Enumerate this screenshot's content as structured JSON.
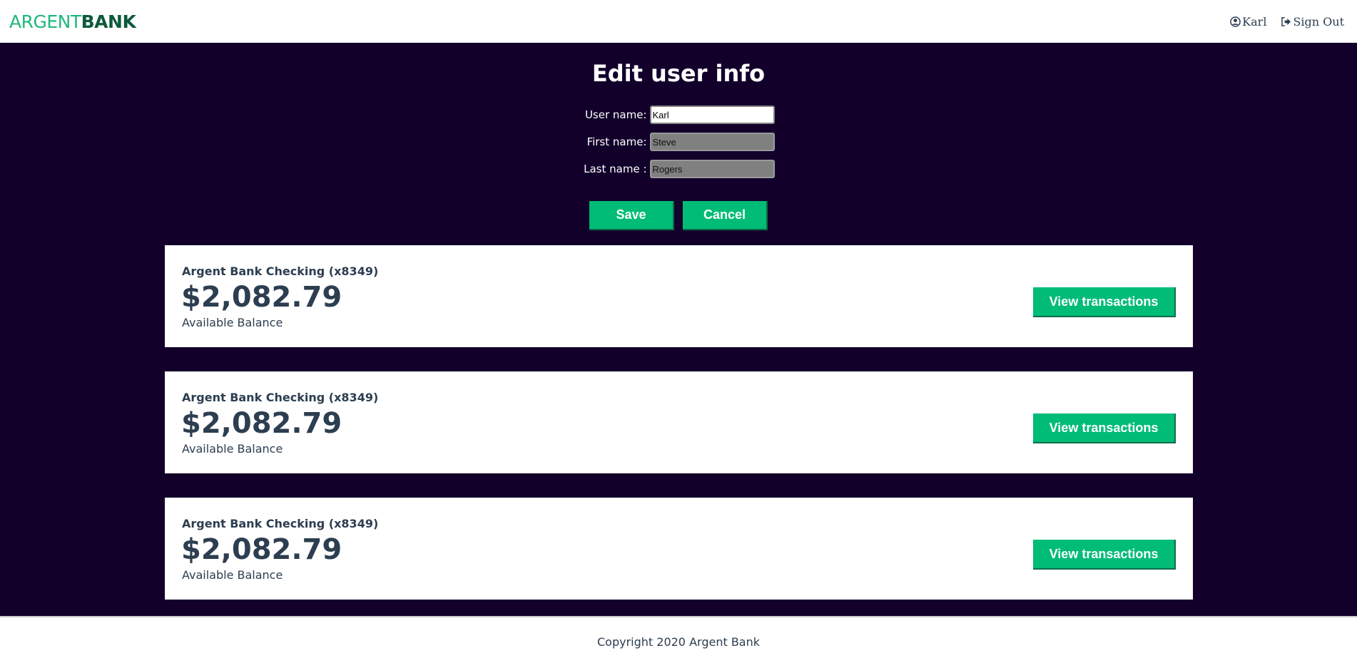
{
  "header": {
    "logo_part1": "ARGENT",
    "logo_part2": "BANK",
    "user_name": "Karl",
    "signout_label": "Sign Out",
    "user_icon": "user-circle-icon",
    "signout_icon": "sign-out-icon"
  },
  "edit_form": {
    "title": "Edit user info",
    "fields": [
      {
        "label": "User name:",
        "value": "Karl",
        "editable": true
      },
      {
        "label": "First name:",
        "value": "Steve",
        "editable": false
      },
      {
        "label": "Last name :",
        "value": "Rogers",
        "editable": false
      }
    ],
    "save_label": "Save",
    "cancel_label": "Cancel"
  },
  "accounts": [
    {
      "title": "Argent Bank Checking (x8349)",
      "amount": "$2,082.79",
      "description": "Available Balance",
      "button_label": "View transactions"
    },
    {
      "title": "Argent Bank Checking (x8349)",
      "amount": "$2,082.79",
      "description": "Available Balance",
      "button_label": "View transactions"
    },
    {
      "title": "Argent Bank Checking (x8349)",
      "amount": "$2,082.79",
      "description": "Available Balance",
      "button_label": "View transactions"
    }
  ],
  "footer": {
    "copyright": "Copyright 2020 Argent Bank"
  },
  "colors": {
    "brand_green": "#00bc77",
    "main_background": "#12002b",
    "text_dark": "#2c3e50"
  }
}
